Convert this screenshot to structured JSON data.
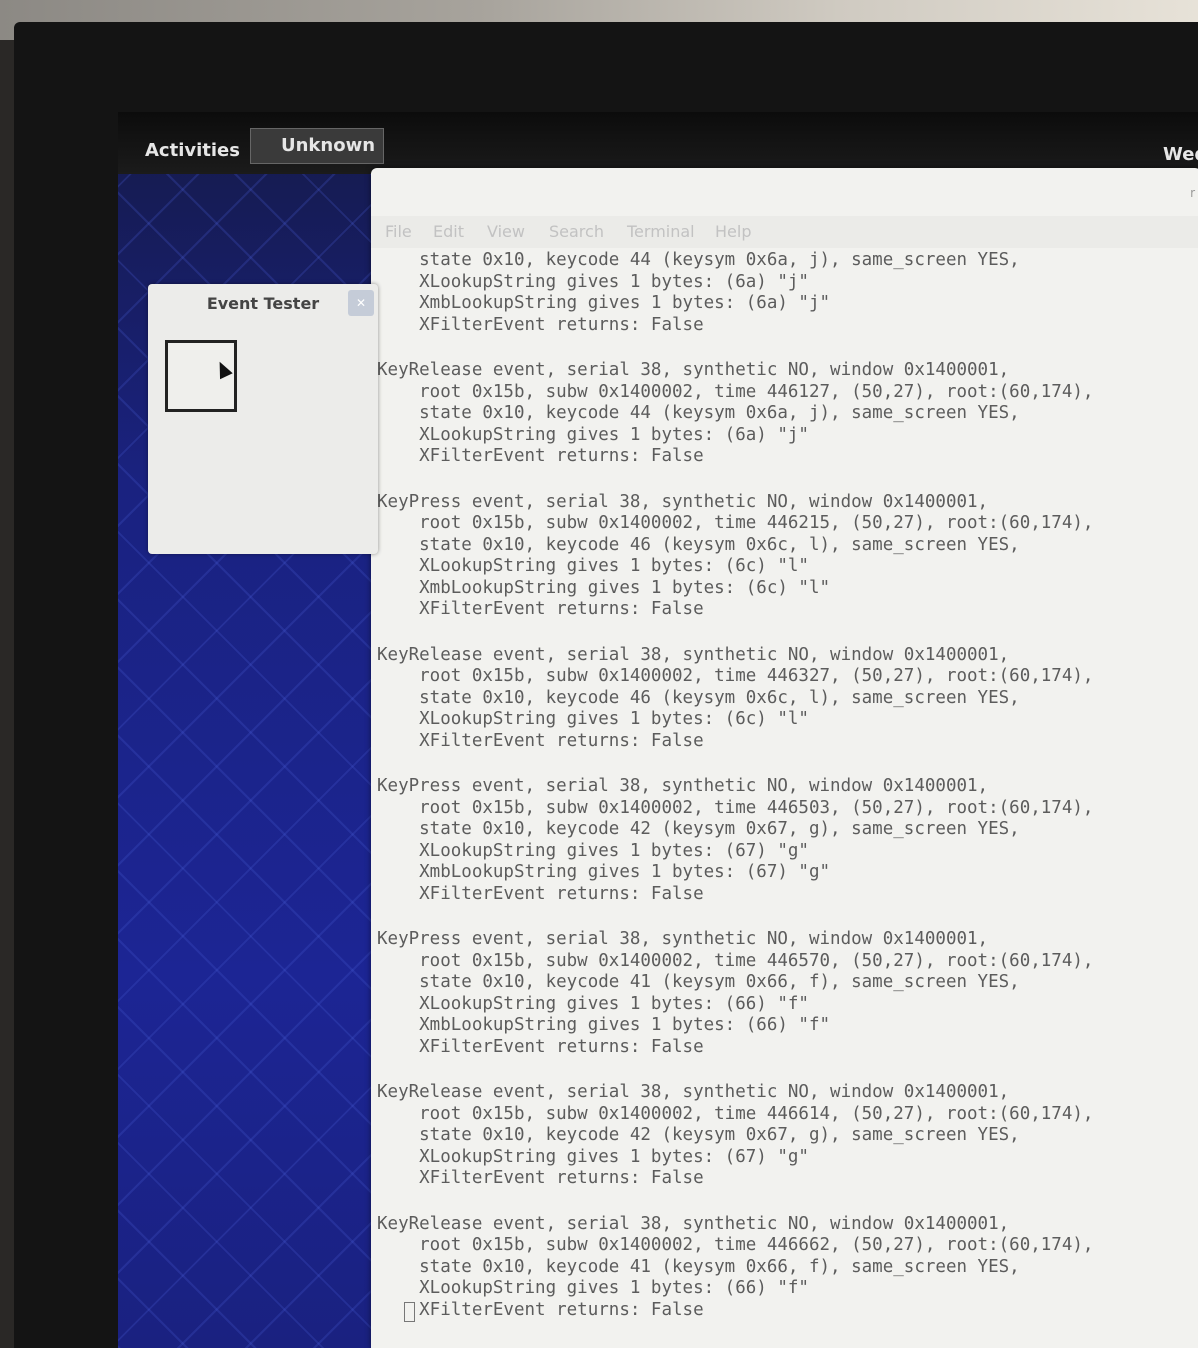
{
  "topbar": {
    "activities": "Activities",
    "app_menu": "Unknown",
    "clock": "Wed"
  },
  "terminal": {
    "menu": [
      "File",
      "Edit",
      "View",
      "Search",
      "Terminal",
      "Help"
    ],
    "events": [
      {
        "lines": [
          "state 0x10, keycode 44 (keysym 0x6a, j), same_screen YES,",
          "XLookupString gives 1 bytes: (6a) \"j\"",
          "XmbLookupString gives 1 bytes: (6a) \"j\"",
          "XFilterEvent returns: False"
        ]
      },
      {
        "lines": [
          "KeyRelease event, serial 38, synthetic NO, window 0x1400001,",
          "    root 0x15b, subw 0x1400002, time 446127, (50,27), root:(60,174),",
          "    state 0x10, keycode 44 (keysym 0x6a, j), same_screen YES,",
          "    XLookupString gives 1 bytes: (6a) \"j\"",
          "    XFilterEvent returns: False"
        ]
      },
      {
        "lines": [
          "KeyPress event, serial 38, synthetic NO, window 0x1400001,",
          "    root 0x15b, subw 0x1400002, time 446215, (50,27), root:(60,174),",
          "    state 0x10, keycode 46 (keysym 0x6c, l), same_screen YES,",
          "    XLookupString gives 1 bytes: (6c) \"l\"",
          "    XmbLookupString gives 1 bytes: (6c) \"l\"",
          "    XFilterEvent returns: False"
        ]
      },
      {
        "lines": [
          "KeyRelease event, serial 38, synthetic NO, window 0x1400001,",
          "    root 0x15b, subw 0x1400002, time 446327, (50,27), root:(60,174),",
          "    state 0x10, keycode 46 (keysym 0x6c, l), same_screen YES,",
          "    XLookupString gives 1 bytes: (6c) \"l\"",
          "    XFilterEvent returns: False"
        ]
      },
      {
        "lines": [
          "KeyPress event, serial 38, synthetic NO, window 0x1400001,",
          "    root 0x15b, subw 0x1400002, time 446503, (50,27), root:(60,174),",
          "    state 0x10, keycode 42 (keysym 0x67, g), same_screen YES,",
          "    XLookupString gives 1 bytes: (67) \"g\"",
          "    XmbLookupString gives 1 bytes: (67) \"g\"",
          "    XFilterEvent returns: False"
        ]
      },
      {
        "lines": [
          "KeyPress event, serial 38, synthetic NO, window 0x1400001,",
          "    root 0x15b, subw 0x1400002, time 446570, (50,27), root:(60,174),",
          "    state 0x10, keycode 41 (keysym 0x66, f), same_screen YES,",
          "    XLookupString gives 1 bytes: (66) \"f\"",
          "    XmbLookupString gives 1 bytes: (66) \"f\"",
          "    XFilterEvent returns: False"
        ]
      },
      {
        "lines": [
          "KeyRelease event, serial 38, synthetic NO, window 0x1400001,",
          "    root 0x15b, subw 0x1400002, time 446614, (50,27), root:(60,174),",
          "    state 0x10, keycode 42 (keysym 0x67, g), same_screen YES,",
          "    XLookupString gives 1 bytes: (67) \"g\"",
          "    XFilterEvent returns: False"
        ]
      },
      {
        "lines": [
          "KeyRelease event, serial 38, synthetic NO, window 0x1400001,",
          "    root 0x15b, subw 0x1400002, time 446662, (50,27), root:(60,174),",
          "    state 0x10, keycode 41 (keysym 0x66, f), same_screen YES,",
          "    XLookupString gives 1 bytes: (66) \"f\"",
          "    XFilterEvent returns: False"
        ]
      }
    ]
  },
  "event_tester": {
    "title": "Event Tester",
    "close_icon": "close-icon",
    "pointer_icon": "mouse-pointer-icon"
  },
  "colors": {
    "desktop_blue": "#1c2594",
    "topbar": "#121212",
    "terminal_bg": "#f2f2ef",
    "terminal_text": "#5c5c5c"
  }
}
